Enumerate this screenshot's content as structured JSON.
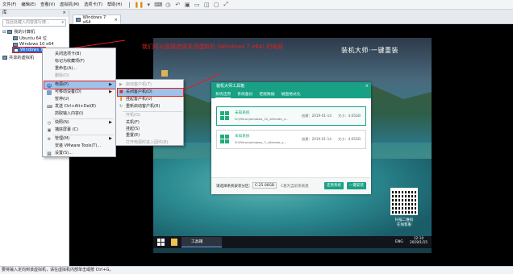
{
  "menubar": {
    "items": [
      "文件(F)",
      "编辑(E)",
      "查看(V)",
      "虚拟机(M)",
      "选项卡(T)",
      "帮助(H)"
    ]
  },
  "library": {
    "title": "库",
    "close": "×",
    "search_placeholder": "在此处键入内容进行搜...",
    "tree": {
      "root": "我的计算机",
      "vm1": "Ubuntu 64 位",
      "vm2": "Windows 10 x64",
      "vm3": "Windows 7",
      "shared": "共享的虚拟机"
    }
  },
  "vmtab": {
    "label": "Windows 7 x64",
    "close": "×"
  },
  "desktop": {
    "caption": "我们可以直接选择关闭虚拟机 (Windows 7 x64) 的电源",
    "logo": "装机大师·一键重装",
    "qr_text": "扫描二维码\n在线客服",
    "taskbar_app": "工具箱",
    "tray_lang": "ENG",
    "clock_time": "12:10",
    "clock_date": "2019/1/15"
  },
  "dialog": {
    "title": "装机大师工具箱",
    "close": "×",
    "tabs": [
      "系统还原",
      "系统备份",
      "老版数据",
      "磁盘格式化"
    ],
    "systems": [
      {
        "name": "未知系统",
        "path": "D:\\Mirror\\windows_10_ultimate_x...",
        "date_label": "创建：2019-01-14",
        "size_label": "大小：4.65GB"
      },
      {
        "name": "未知系统",
        "path": "D:\\Mirror\\windows_7_ultimate_x...",
        "date_label": "创建：2019-01-14",
        "size_label": "大小：4.65GB"
      }
    ],
    "bottom": {
      "label": "请选择系统安装分区：",
      "drive": "C:25.00GB",
      "drive_note": "C盘为当前系统盘",
      "restore_btn": "还原系统",
      "oneclick_btn": "一键安装"
    }
  },
  "context_menu": {
    "items": [
      {
        "label": "关闭选项卡(B)",
        "shortcut": "",
        "disabled": false,
        "icon": ""
      },
      {
        "label": "标记为收藏项(F)",
        "shortcut": "",
        "disabled": false,
        "icon": ""
      },
      {
        "label": "重命名(A)...",
        "shortcut": "",
        "disabled": false,
        "icon": ""
      },
      {
        "label": "删除(D)",
        "shortcut": "",
        "disabled": true,
        "icon": ""
      },
      {
        "label": "电源(P)",
        "shortcut": "▶",
        "disabled": false,
        "icon": "power-icon",
        "highlight": true
      },
      {
        "label": "可移动设备(D)",
        "shortcut": "▶",
        "disabled": false,
        "icon": ""
      },
      {
        "label": "暂停(U)",
        "shortcut": "",
        "disabled": false,
        "icon": ""
      },
      {
        "label": "发送 Ctrl+Alt+Del(E)",
        "shortcut": "",
        "disabled": false,
        "icon": ""
      },
      {
        "label": "抓取输入内容(I)",
        "shortcut": "",
        "disabled": false,
        "icon": ""
      },
      {
        "label": "快照(N)",
        "shortcut": "▶",
        "disabled": false,
        "icon": ""
      },
      {
        "label": "捕获屏幕 (C)",
        "shortcut": "",
        "disabled": false,
        "icon": ""
      },
      {
        "label": "管理(M)",
        "shortcut": "▶",
        "disabled": false,
        "icon": ""
      },
      {
        "label": "安装 VMware Tools(T)...",
        "shortcut": "",
        "disabled": false,
        "icon": ""
      },
      {
        "label": "设置(S)...",
        "shortcut": "",
        "disabled": false,
        "icon": ""
      }
    ]
  },
  "submenu": {
    "items": [
      {
        "label": "启动客户机(T)",
        "disabled": true
      },
      {
        "label": "关闭客户机(D)",
        "disabled": false,
        "highlight": true
      },
      {
        "label": "挂起客户机(U)",
        "disabled": false
      },
      {
        "label": "重新启动客户机(R)",
        "disabled": false
      },
      {
        "label": "开机(O)",
        "disabled": true
      },
      {
        "label": "关机(F)",
        "disabled": false
      },
      {
        "label": "挂起(S)",
        "disabled": false
      },
      {
        "label": "重置(E)",
        "disabled": false
      },
      {
        "label": "打开电源时进入固件(B)",
        "disabled": true
      }
    ]
  },
  "statusbar": {
    "text": "要将输入定向到该虚拟机，请在虚拟机内部单击或按 Ctrl+G。"
  },
  "colors": {
    "accent": "#18a185",
    "highlight": "#9fc2ea",
    "annotation": "#e02020"
  }
}
